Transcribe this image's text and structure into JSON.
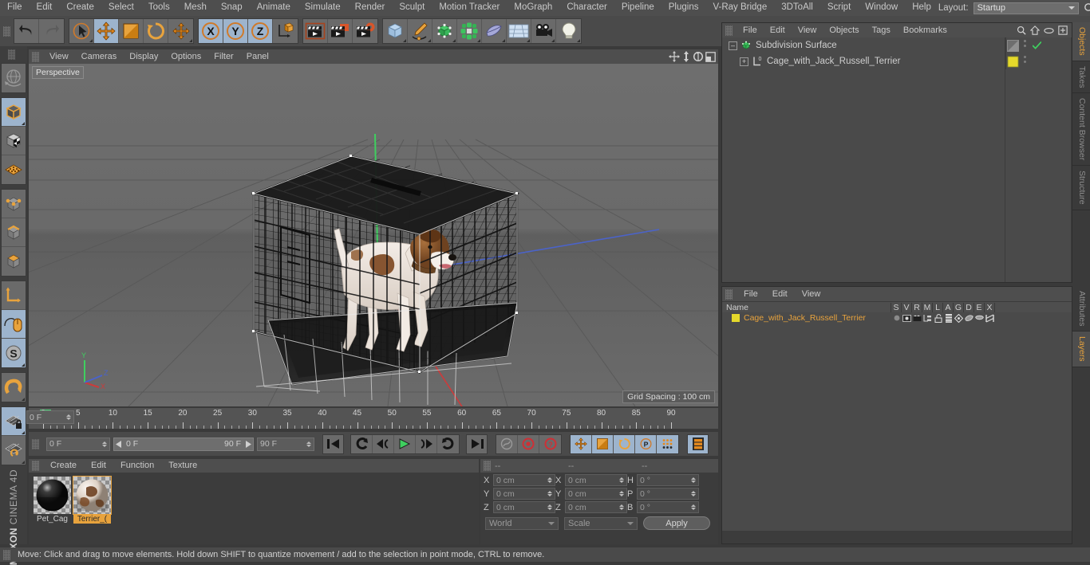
{
  "menubar": {
    "items": [
      "File",
      "Edit",
      "Create",
      "Select",
      "Tools",
      "Mesh",
      "Snap",
      "Animate",
      "Simulate",
      "Render",
      "Sculpt",
      "Motion Tracker",
      "MoGraph",
      "Character",
      "Pipeline",
      "Plugins",
      "V-Ray Bridge",
      "3DToAll",
      "Script",
      "Window",
      "Help"
    ],
    "layout_label": "Layout:",
    "layout_value": "Startup",
    "search_icon": "search-icon"
  },
  "toolbar": {
    "groups": [
      {
        "name": "history",
        "buttons": [
          {
            "icon": "undo-icon",
            "label": "Undo",
            "active": false
          },
          {
            "icon": "redo-icon",
            "label": "Redo",
            "active": false
          }
        ]
      },
      {
        "name": "tools",
        "buttons": [
          {
            "icon": "select-live-icon",
            "label": "Live Selection",
            "active": false
          },
          {
            "icon": "move-icon",
            "label": "Move",
            "active": true
          },
          {
            "icon": "scale-icon",
            "label": "Scale",
            "active": false
          },
          {
            "icon": "rotate-icon",
            "label": "Rotate",
            "active": false
          },
          {
            "icon": "move-alt-icon",
            "label": "Move",
            "active": false
          }
        ]
      },
      {
        "name": "axis-locks",
        "buttons": [
          {
            "icon": "x-axis-icon",
            "label": "X",
            "active": true
          },
          {
            "icon": "y-axis-icon",
            "label": "Y",
            "active": true
          },
          {
            "icon": "z-axis-icon",
            "label": "Z",
            "active": true
          },
          {
            "icon": "world-axis-icon",
            "label": "World/Object",
            "active": false
          }
        ]
      },
      {
        "name": "render",
        "buttons": [
          {
            "icon": "render-view-icon",
            "label": "Render View",
            "active": false
          },
          {
            "icon": "render-region-icon",
            "label": "Render to Picture Viewer",
            "active": false
          },
          {
            "icon": "render-settings-icon",
            "label": "Edit Render Settings",
            "active": false
          }
        ]
      },
      {
        "name": "create",
        "buttons": [
          {
            "icon": "cube-primitive-icon",
            "label": "Add Cube Object",
            "active": false
          },
          {
            "icon": "spline-pen-icon",
            "label": "Pen",
            "active": false
          },
          {
            "icon": "nurbs-icon",
            "label": "Subdivision Surface",
            "active": false
          },
          {
            "icon": "mograph-icon",
            "label": "MoGraph",
            "active": false
          },
          {
            "icon": "deformer-icon",
            "label": "Bend Deformer",
            "active": false
          },
          {
            "icon": "floor-icon",
            "label": "Floor",
            "active": false
          },
          {
            "icon": "camera-icon",
            "label": "Camera",
            "active": false
          },
          {
            "icon": "light-icon",
            "label": "Light",
            "active": false
          }
        ]
      }
    ]
  },
  "lefttool": {
    "groups": [
      {
        "buttons": [
          {
            "icon": "undo-view-icon",
            "active": false
          }
        ]
      },
      {
        "buttons": [
          {
            "icon": "model-mode-icon",
            "active": true
          },
          {
            "icon": "texture-mode-icon",
            "active": false
          },
          {
            "icon": "workplane-icon",
            "active": false
          }
        ]
      },
      {
        "buttons": [
          {
            "icon": "points-mode-icon",
            "active": false
          },
          {
            "icon": "edges-mode-icon",
            "active": false
          },
          {
            "icon": "polygons-mode-icon",
            "active": false
          }
        ]
      },
      {
        "buttons": [
          {
            "icon": "axis-modify-icon",
            "active": false
          },
          {
            "icon": "enable-snap-icon",
            "active": true
          },
          {
            "icon": "quantize-icon",
            "active": true
          }
        ]
      },
      {
        "buttons": [
          {
            "icon": "magnet-icon",
            "active": false
          }
        ]
      },
      {
        "buttons": [
          {
            "icon": "workplane-lock-icon",
            "active": true
          },
          {
            "icon": "workplane-align-icon",
            "active": false
          }
        ]
      }
    ],
    "brand_top": "MAXON",
    "brand_bottom": "CINEMA 4D"
  },
  "viewport": {
    "menu": [
      "View",
      "Cameras",
      "Display",
      "Options",
      "Filter",
      "Panel"
    ],
    "nav_icons": [
      "pan-icon",
      "dolly-icon",
      "orbit-icon",
      "maximize-icon"
    ],
    "label": "Perspective",
    "grid_spacing": "Grid Spacing : 100 cm",
    "axis_gizmo": {
      "x": "X",
      "y": "Y",
      "z": "Z"
    },
    "scene_description": "Black wire pet cage containing a Jack Russell Terrier standing on a dark plastic tray"
  },
  "timeline": {
    "ticks": [
      0,
      5,
      10,
      15,
      20,
      25,
      30,
      35,
      40,
      45,
      50,
      55,
      60,
      65,
      70,
      75,
      80,
      85,
      90
    ],
    "current_frame_field": "0 F",
    "playhead_frame": 0
  },
  "transport": {
    "current_frame": "0 F",
    "range_start": "0 F",
    "range_end": "90 F",
    "end_frame": "90 F",
    "buttons": [
      {
        "icon": "go-to-start-icon"
      },
      {
        "icon": "prev-key-icon"
      },
      {
        "icon": "step-back-icon"
      },
      {
        "icon": "play-icon"
      },
      {
        "icon": "step-forward-icon"
      },
      {
        "icon": "next-key-icon"
      },
      {
        "icon": "go-to-end-icon"
      }
    ],
    "record_group": [
      {
        "icon": "autokey-icon"
      },
      {
        "icon": "record-icon"
      },
      {
        "icon": "record-help-icon"
      }
    ],
    "key_group": [
      {
        "icon": "key-position-icon",
        "active": true
      },
      {
        "icon": "key-scale-icon",
        "active": true
      },
      {
        "icon": "key-rotation-icon",
        "active": true
      },
      {
        "icon": "key-param-icon",
        "active": true
      },
      {
        "icon": "key-pla-icon",
        "active": true
      }
    ],
    "film_button": {
      "icon": "timeline-icon",
      "active": true
    }
  },
  "material_manager": {
    "menu": [
      "Create",
      "Edit",
      "Function",
      "Texture"
    ],
    "materials": [
      {
        "name": "Pet_Cag",
        "full_name": "Pet_Cage",
        "selected": false,
        "swatch": "#1b1b1b"
      },
      {
        "name": "Terrier_(",
        "full_name": "Terrier_Color",
        "selected": true,
        "swatch": "#cbb8ac"
      }
    ]
  },
  "coordinates": {
    "header_dashes": [
      "--",
      "--",
      "--"
    ],
    "rows": [
      {
        "pos_label": "X",
        "pos_value": "0 cm",
        "size_label": "X",
        "size_value": "0 cm",
        "rot_label": "H",
        "rot_value": "0 °"
      },
      {
        "pos_label": "Y",
        "pos_value": "0 cm",
        "size_label": "Y",
        "size_value": "0 cm",
        "rot_label": "P",
        "rot_value": "0 °"
      },
      {
        "pos_label": "Z",
        "pos_value": "0 cm",
        "size_label": "Z",
        "size_value": "0 cm",
        "rot_label": "B",
        "rot_value": "0 °"
      }
    ],
    "system_select": "World",
    "mode_select": "Scale",
    "apply_label": "Apply"
  },
  "object_manager": {
    "menu": [
      "File",
      "Edit",
      "View",
      "Objects",
      "Tags",
      "Bookmarks"
    ],
    "header_icons": [
      "search-icon",
      "home-icon",
      "eye-icon",
      "expand-icon"
    ],
    "rows": [
      {
        "name": "Subdivision Surface",
        "icon": "subdivision-surface-icon",
        "indent": 0,
        "expander": "-",
        "tag": "display-tag",
        "check": true
      },
      {
        "name": "Cage_with_Jack_Russell_Terrier",
        "icon": "polygon-object-icon",
        "indent": 1,
        "expander": "+",
        "tag": "yellow-layer-tag",
        "check": false
      }
    ]
  },
  "layer_manager": {
    "menu": [
      "File",
      "Edit",
      "View"
    ],
    "columns": [
      "Name",
      "S",
      "V",
      "R",
      "M",
      "L",
      "A",
      "G",
      "D",
      "E",
      "X"
    ],
    "rows": [
      {
        "name": "Cage_with_Jack_Russell_Terrier",
        "color": "#e5d92b",
        "icons": [
          "solo-dot-icon",
          "view-icon",
          "render-icon",
          "manager-icon",
          "lock-open-icon",
          "animation-icon",
          "generator-icon",
          "deformer-icon",
          "expression-icon",
          "xpresso-icon"
        ]
      }
    ]
  },
  "right_tabs_top": [
    "Objects",
    "Takes",
    "Content Browser",
    "Structure"
  ],
  "right_tabs_bottom": [
    "Attributes",
    "Layers"
  ],
  "statusbar": {
    "text": "Move: Click and drag to move elements. Hold down SHIFT to quantize movement / add to the selection in point mode, CTRL to remove."
  },
  "colors": {
    "accent_orange": "#e8a33d",
    "active_blue": "#9db4cd",
    "panel_bg": "#3c3c3c",
    "chrome_bg": "#4e4e4e",
    "green_axis": "#49e07a",
    "layer_yellow": "#e5d92b"
  }
}
